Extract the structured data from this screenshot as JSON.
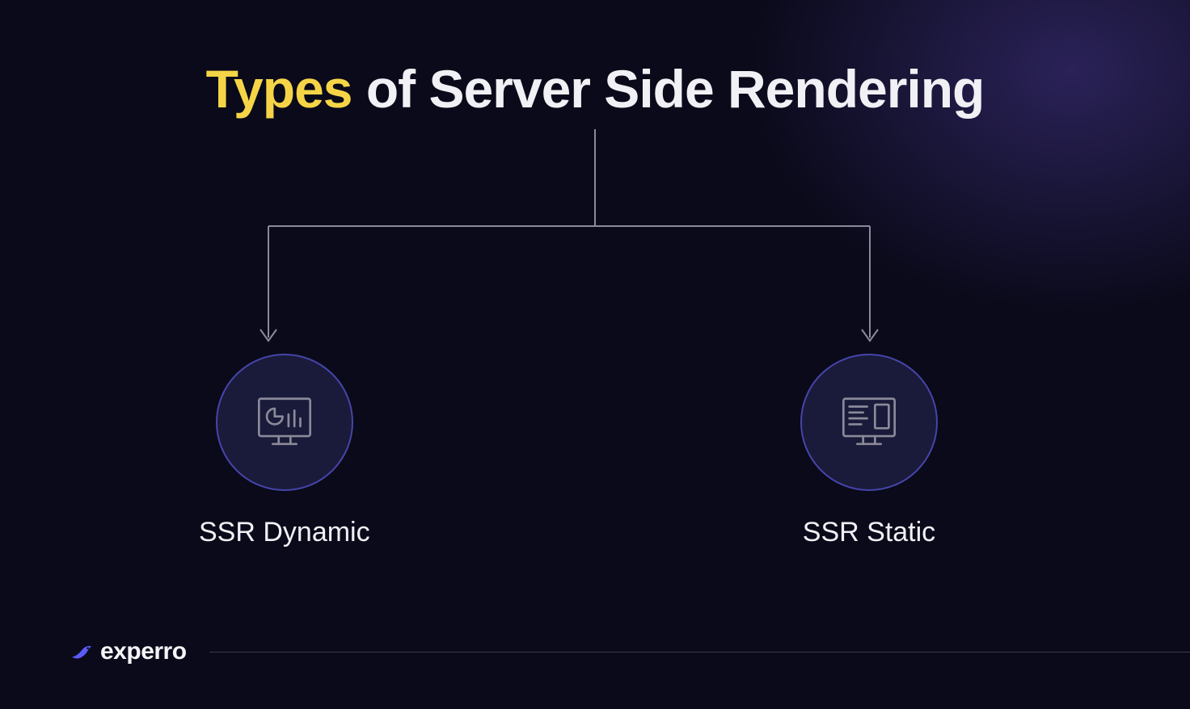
{
  "diagram": {
    "title_highlight": "Types",
    "title_rest": " of Server Side Rendering",
    "nodes": [
      {
        "label": "SSR Dynamic",
        "icon": "dashboard-icon"
      },
      {
        "label": "SSR Static",
        "icon": "layout-icon"
      }
    ]
  },
  "footer": {
    "brand": "experro"
  },
  "colors": {
    "highlight": "#f5d547",
    "text": "#f0f0f5",
    "circle_border": "#4545aa",
    "circle_fill": "#1a1a3a",
    "connector": "#8a8a9a",
    "bg_dark": "#0a0a1a"
  }
}
